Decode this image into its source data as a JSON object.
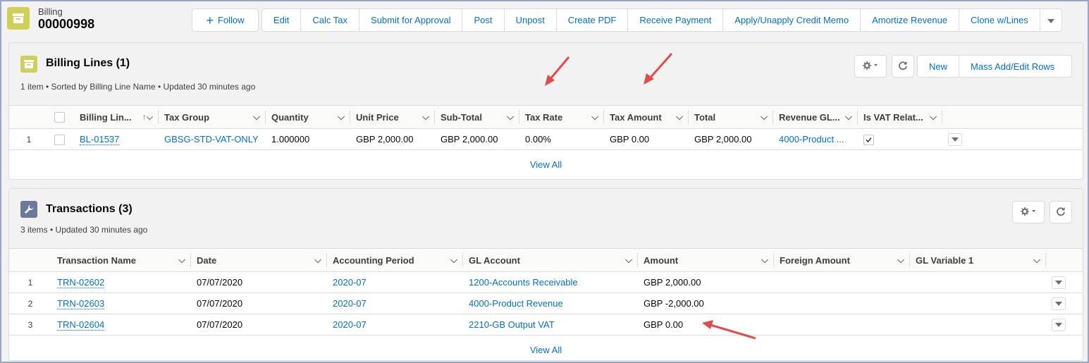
{
  "header": {
    "record_type": "Billing",
    "record_name": "00000998",
    "follow_label": "Follow",
    "actions": [
      "Edit",
      "Calc Tax",
      "Submit for Approval",
      "Post",
      "Unpost",
      "Create PDF",
      "Receive Payment",
      "Apply/Unapply Credit Memo",
      "Amortize Revenue",
      "Clone w/Lines"
    ]
  },
  "billing_lines": {
    "title": "Billing Lines (1)",
    "subtitle": "1 item • Sorted by Billing Line Name • Updated 30 minutes ago",
    "new_label": "New",
    "mass_label": "Mass Add/Edit Rows",
    "columns": [
      "Billing Lin...",
      "Tax Group",
      "Quantity",
      "Unit Price",
      "Sub-Total",
      "Tax Rate",
      "Tax Amount",
      "Total",
      "Revenue GL...",
      "Is VAT Relat..."
    ],
    "rows": [
      {
        "num": "1",
        "name": "BL-01537",
        "tax_group": "GBSG-STD-VAT-ONLY",
        "quantity": "1.000000",
        "unit_price": "GBP 2,000.00",
        "subtotal": "GBP 2,000.00",
        "tax_rate": "0.00%",
        "tax_amount": "GBP 0.00",
        "total": "GBP 2,000.00",
        "revenue_gl": "4000-Product ..."
      }
    ],
    "view_all": "View All"
  },
  "transactions": {
    "title": "Transactions (3)",
    "subtitle": "3 items • Updated 30 minutes ago",
    "columns": [
      "Transaction Name",
      "Date",
      "Accounting Period",
      "GL Account",
      "Amount",
      "Foreign Amount",
      "GL Variable 1"
    ],
    "rows": [
      {
        "num": "1",
        "name": "TRN-02602",
        "date": "07/07/2020",
        "period": "2020-07",
        "gl": "1200-Accounts Receivable",
        "amount": "GBP 2,000.00"
      },
      {
        "num": "2",
        "name": "TRN-02603",
        "date": "07/07/2020",
        "period": "2020-07",
        "gl": "4000-Product Revenue",
        "amount": "GBP -2,000.00"
      },
      {
        "num": "3",
        "name": "TRN-02604",
        "date": "07/07/2020",
        "period": "2020-07",
        "gl": "2210-GB Output VAT",
        "amount": "GBP 0.00"
      }
    ],
    "view_all": "View All"
  },
  "colors": {
    "billing_icon": "#cfd05b",
    "transactions_icon": "#6b7a9b",
    "link": "#0070d2",
    "annotation_arrow": "#e24b4b"
  }
}
